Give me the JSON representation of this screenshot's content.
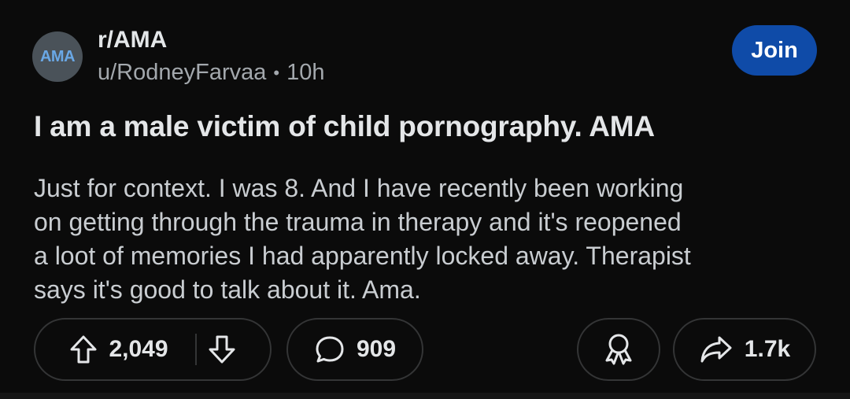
{
  "post": {
    "avatar_text": "AMA",
    "subreddit": "r/AMA",
    "author": "u/RodneyFarvaa",
    "separator": "•",
    "age": "10h",
    "join_label": "Join",
    "title": "I am a male victim of child pornography. AMA",
    "body_lines": [
      "Just for context. I was 8. And I have recently been working",
      "on getting through the trauma in therapy and it's reopened",
      "a loot of memories I had apparently locked away. Therapist",
      "says it's good to talk about it. Ama."
    ]
  },
  "actions": {
    "upvote_icon": "arrow-up-icon",
    "downvote_icon": "arrow-down-icon",
    "score": "2,049",
    "comment_icon": "comment-bubble-icon",
    "comments": "909",
    "award_icon": "award-ribbon-icon",
    "share_icon": "share-arrow-icon",
    "shares": "1.7k"
  },
  "colors": {
    "background": "#0b0b0b",
    "join_button": "#0f4ba8",
    "pill_border": "#343536"
  }
}
